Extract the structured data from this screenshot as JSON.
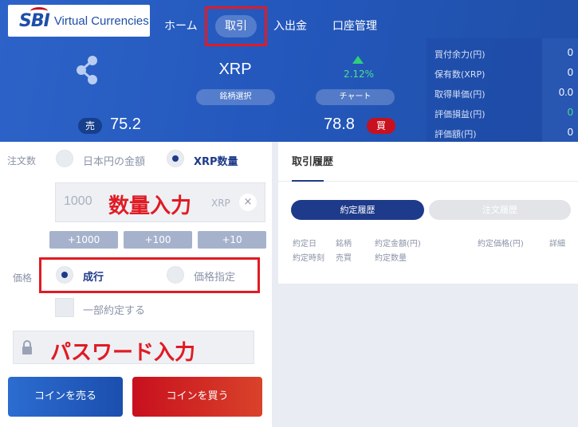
{
  "header": {
    "logo_main": "SBI",
    "logo_sub": "Virtual Currencies",
    "nav": [
      {
        "label": "ホーム"
      },
      {
        "label": "取引"
      },
      {
        "label": "入出金"
      },
      {
        "label": "口座管理"
      }
    ],
    "active_nav": "取引",
    "coin": "XRP",
    "coin_icon": "xrp-logo",
    "symbol_select_label": "銘柄選択",
    "chart_label": "チャート",
    "change_pct": "2.12%",
    "change_direction": "up",
    "sell_badge": "売",
    "sell_price": "75.2",
    "buy_price": "78.8",
    "buy_badge": "買",
    "colors": {
      "accent": "#2458bd",
      "buy": "#c8101e",
      "sell_badge": "#163f8c",
      "up": "#2fd07a",
      "annotation": "#e01b24"
    }
  },
  "account": {
    "rows": [
      {
        "label": "買付余力(円)",
        "value": "0"
      },
      {
        "label": "保有数(XRP)",
        "value": "0"
      },
      {
        "label": "取得単価(円)",
        "value": "0.0"
      },
      {
        "label": "評価損益(円)",
        "value": "0"
      },
      {
        "label": "評価額(円)",
        "value": "0"
      }
    ]
  },
  "order": {
    "qty_label": "注文数",
    "qty_mode_yen": "日本円の金額",
    "qty_mode_coin": "XRP数量",
    "qty_mode_selected": "XRP数量",
    "qty_value": "1000",
    "qty_annotation": "数量入力",
    "qty_unit": "XRP",
    "qty_clear": "×",
    "increments": [
      "+1000",
      "+100",
      "+10"
    ],
    "price_label": "価格",
    "price_market": "成行",
    "price_limit": "価格指定",
    "price_selected": "成行",
    "partial_label": "一部約定する",
    "password_annotation": "パスワード入力",
    "sell_button": "コインを売る",
    "buy_button": "コインを買う"
  },
  "history": {
    "title": "取引履歴",
    "tabs": [
      {
        "label": "約定履歴",
        "active": true
      },
      {
        "label": "注文履歴",
        "active": false
      }
    ],
    "columns_row1": [
      "約定日",
      "銘柄",
      "約定金額(円)",
      "約定価格(円)",
      "詳細"
    ],
    "columns_row2": [
      "約定時刻",
      "売買",
      "約定数量"
    ]
  }
}
